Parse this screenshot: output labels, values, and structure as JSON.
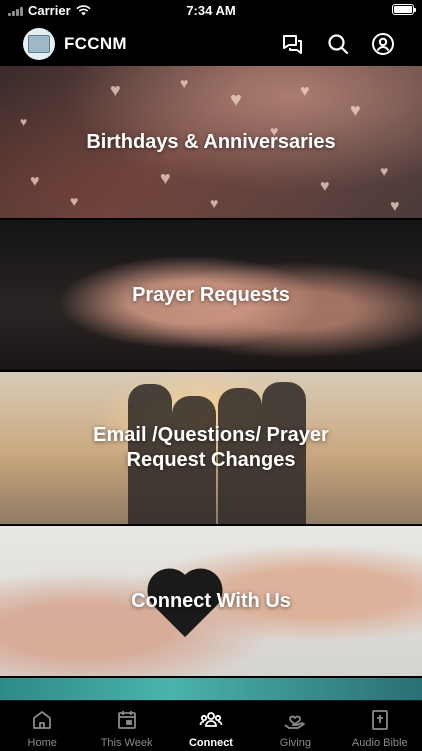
{
  "status_bar": {
    "carrier": "Carrier",
    "time": "7:34 AM"
  },
  "header": {
    "title": "FCCNM",
    "icons": [
      "chat-icon",
      "search-icon",
      "profile-icon"
    ]
  },
  "tiles": [
    {
      "label": "Birthdays & Anniversaries"
    },
    {
      "label": "Prayer Requests"
    },
    {
      "label": "Email /Questions/ Prayer Request Changes"
    },
    {
      "label": "Connect With Us"
    }
  ],
  "tab_bar": {
    "active_index": 2,
    "items": [
      {
        "label": "Home",
        "icon": "home-icon"
      },
      {
        "label": "This Week",
        "icon": "calendar-icon"
      },
      {
        "label": "Connect",
        "icon": "people-icon"
      },
      {
        "label": "Giving",
        "icon": "giving-icon"
      },
      {
        "label": "Audio Bible",
        "icon": "bible-icon"
      }
    ]
  },
  "colors": {
    "background": "#000000",
    "active_tab": "#ffffff",
    "inactive_tab": "#8a8a8a"
  }
}
